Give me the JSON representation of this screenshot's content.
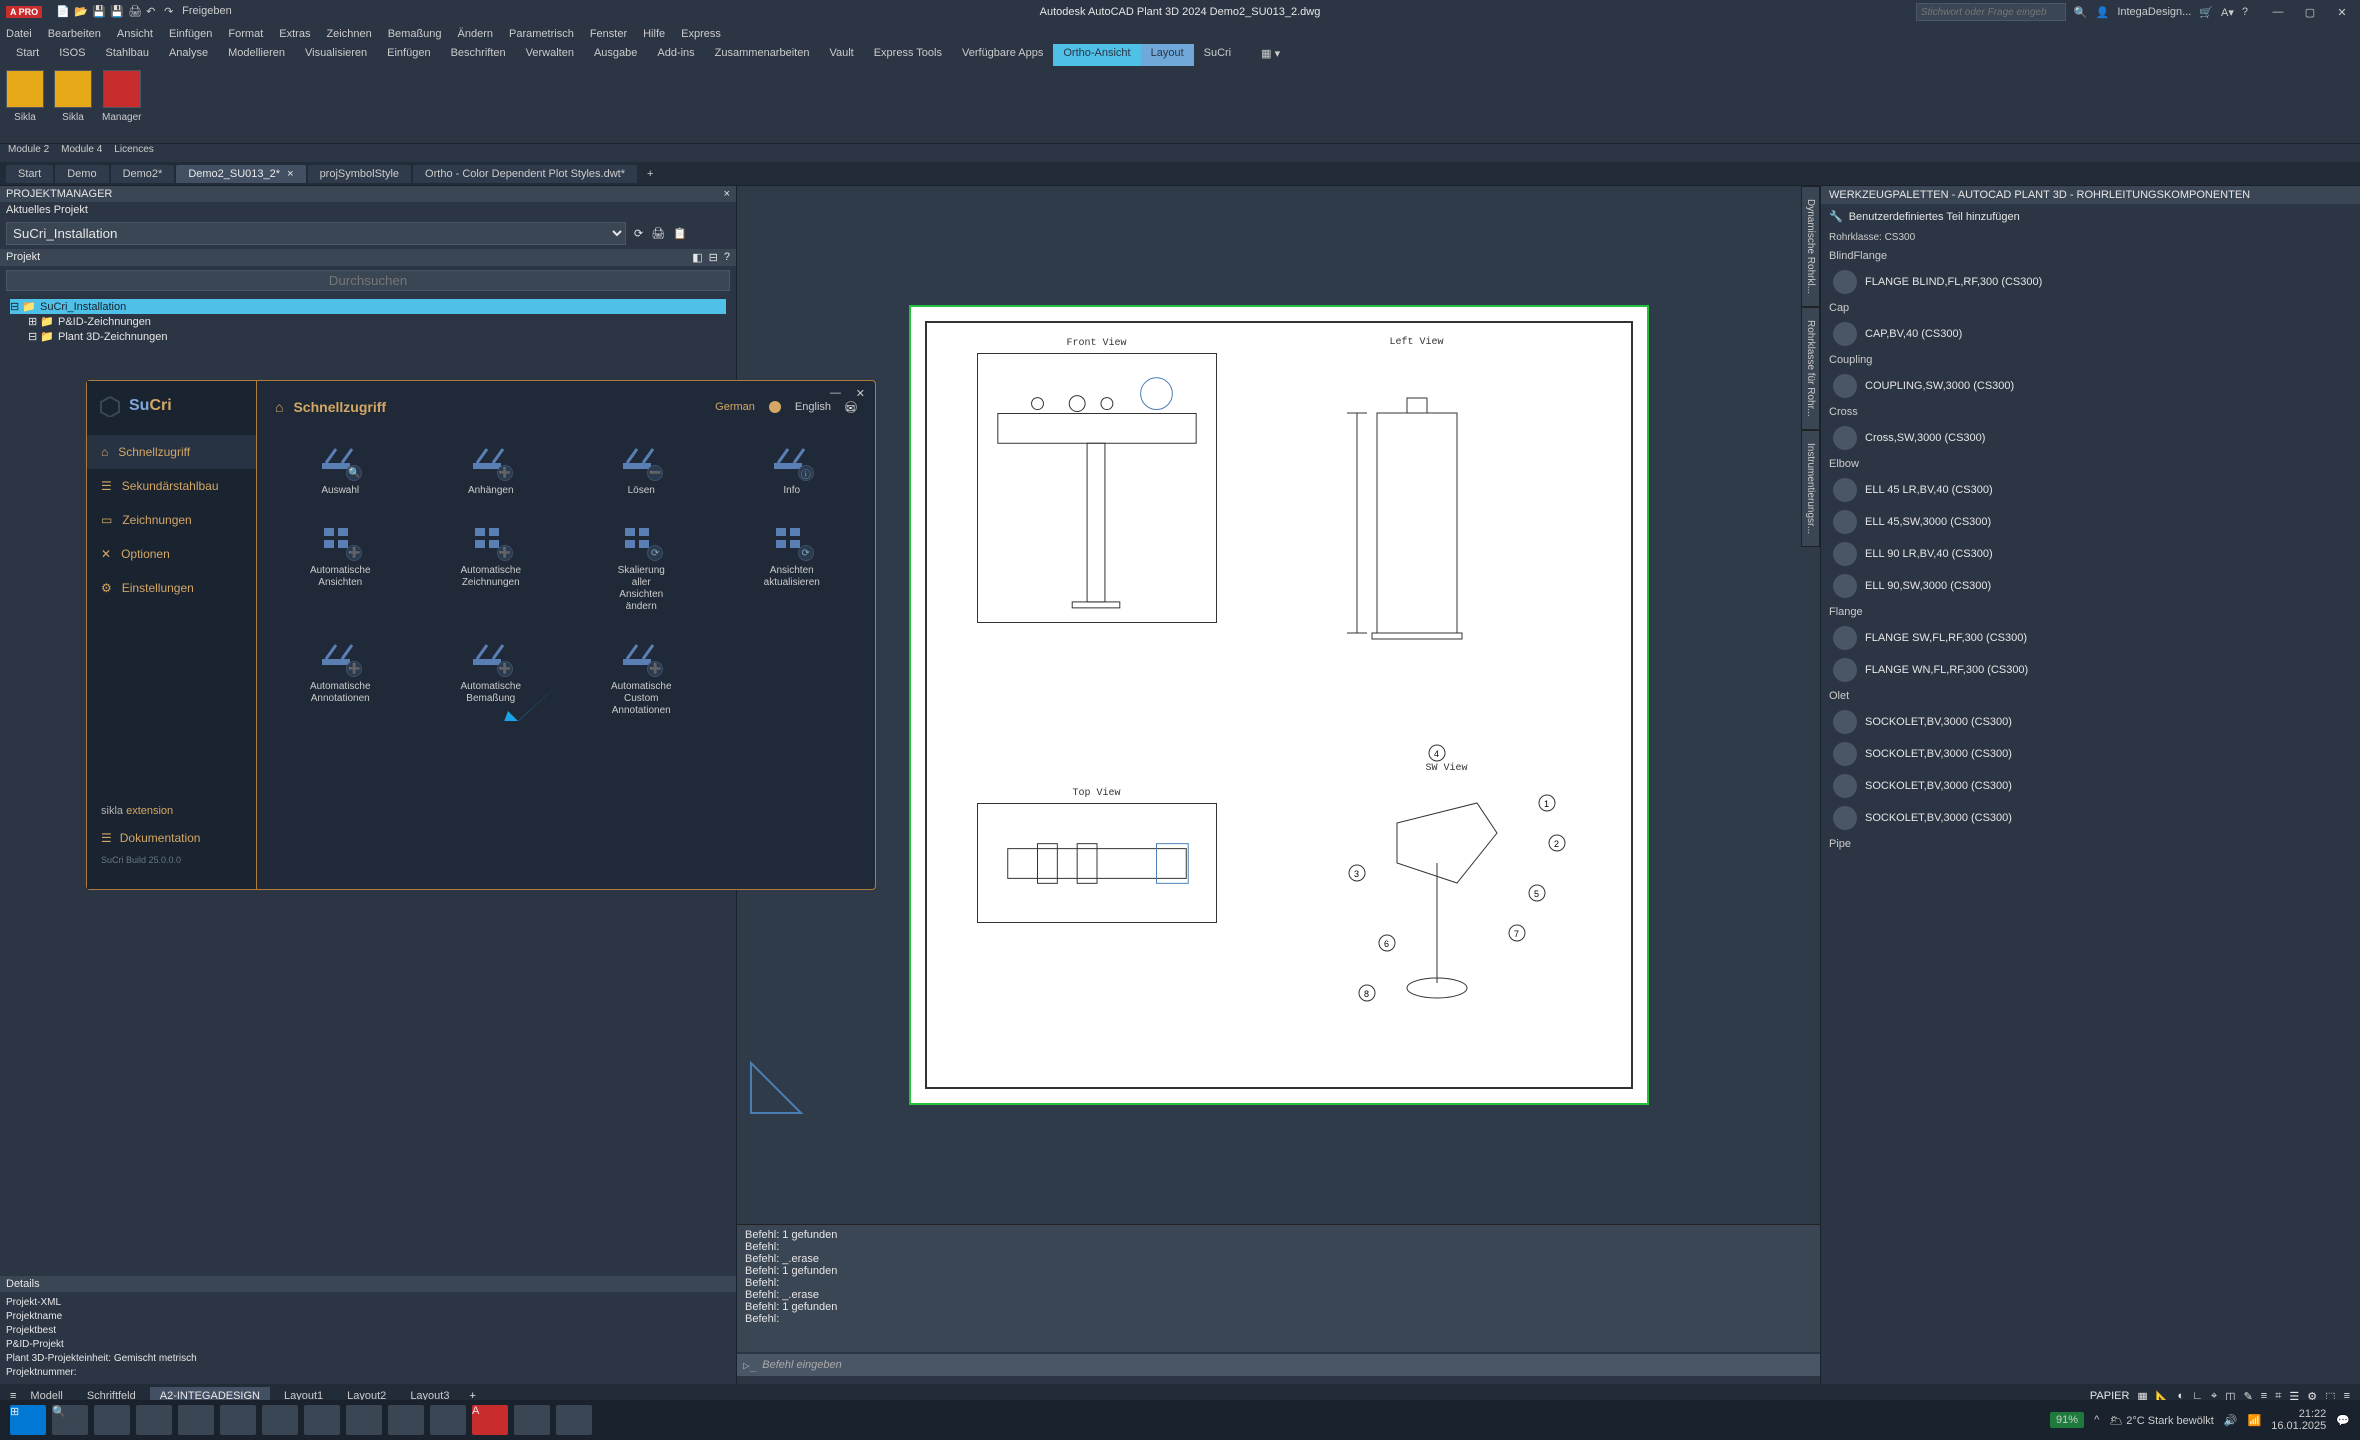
{
  "app": {
    "title": "Autodesk AutoCAD Plant 3D 2024   Demo2_SU013_2.dwg",
    "logo": "A PRO",
    "share": "Freigeben",
    "search_ph": "Stichwort oder Frage eingeben",
    "user": "IntegaDesign..."
  },
  "menus": [
    "Datei",
    "Bearbeiten",
    "Ansicht",
    "Einfügen",
    "Format",
    "Extras",
    "Zeichnen",
    "Bemaßung",
    "Ändern",
    "Parametrisch",
    "Fenster",
    "Hilfe",
    "Express"
  ],
  "ribbon_tabs": [
    "Start",
    "ISOS",
    "Stahlbau",
    "Analyse",
    "Modellieren",
    "Visualisieren",
    "Einfügen",
    "Beschriften",
    "Verwalten",
    "Ausgabe",
    "Add-ins",
    "Zusammenarbeiten",
    "Vault",
    "Express Tools",
    "Verfügbare Apps",
    "Ortho-Ansicht",
    "Layout",
    "SuCri"
  ],
  "ribbon_active": 15,
  "ribbon_active2": 16,
  "ribbon": {
    "g1": "Sikla",
    "g2": "Sikla",
    "g3": "Manager"
  },
  "ribbon_footer": [
    "Module 2",
    "Module 4",
    "Licences"
  ],
  "filetabs": [
    "Start",
    "Demo",
    "Demo2*",
    "Demo2_SU013_2*",
    "projSymbolStyle",
    "Ortho - Color Dependent Plot Styles.dwt*"
  ],
  "filetabs_active": 3,
  "project": {
    "panel": "PROJEKTMANAGER",
    "current_label": "Aktuelles Projekt",
    "current": "SuCri_Installation",
    "section": "Projekt",
    "search_ph": "Durchsuchen",
    "tree": {
      "root": "SuCri_Installation",
      "n1": "P&ID-Zeichnungen",
      "n2": "Plant 3D-Zeichnungen"
    },
    "details": "Details",
    "det_lines": [
      "Projekt-XML",
      "Projektname",
      "Projektbest",
      "P&ID-Projekt",
      "Plant 3D-Projekteinheit: Gemischt  metrisch",
      "Projektnummer:"
    ]
  },
  "right_panel": {
    "title": "WERKZEUGPALETTEN - AUTOCAD PLANT 3D - ROHRLEITUNGSKOMPONENTEN",
    "add_label": "Benutzerdefiniertes Teil hinzufügen",
    "class_label": "Rohrklasse: CS300",
    "side_tabs": [
      "Dynamische Rohrkl...",
      "Rohrklasse für Rohr...",
      "Instrumentierungsr..."
    ],
    "cats": [
      {
        "name": "BlindFlange",
        "items": [
          "FLANGE BLIND,FL,RF,300 (CS300)"
        ]
      },
      {
        "name": "Cap",
        "items": [
          "CAP,BV,40 (CS300)"
        ]
      },
      {
        "name": "Coupling",
        "items": [
          "COUPLING,SW,3000 (CS300)"
        ]
      },
      {
        "name": "Cross",
        "items": [
          "Cross,SW,3000 (CS300)"
        ]
      },
      {
        "name": "Elbow",
        "items": [
          "ELL 45 LR,BV,40 (CS300)",
          "ELL 45,SW,3000 (CS300)",
          "ELL 90 LR,BV,40 (CS300)",
          "ELL 90,SW,3000 (CS300)"
        ]
      },
      {
        "name": "Flange",
        "items": [
          "FLANGE SW,FL,RF,300 (CS300)",
          "FLANGE WN,FL,RF,300 (CS300)"
        ]
      },
      {
        "name": "Olet",
        "items": [
          "SOCKOLET,BV,3000 (CS300)",
          "SOCKOLET,BV,3000 (CS300)",
          "SOCKOLET,BV,3000 (CS300)",
          "SOCKOLET,BV,3000 (CS300)"
        ]
      },
      {
        "name": "Pipe",
        "items": []
      }
    ]
  },
  "views": {
    "front": "Front View",
    "left": "Left View",
    "top": "Top View",
    "sw": "SW View"
  },
  "cmd": {
    "history": [
      "Befehl: 1 gefunden",
      "Befehl:",
      "Befehl: _.erase",
      "Befehl: 1 gefunden",
      "Befehl:",
      "Befehl: _.erase",
      "Befehl: 1 gefunden",
      "Befehl:"
    ],
    "prompt": "Befehl eingeben"
  },
  "bottom_tabs": [
    "Modell",
    "Schriftfeld",
    "A2-INTEGADESIGN",
    "Layout1",
    "Layout2",
    "Layout3"
  ],
  "bottom_active": 2,
  "status": {
    "paper": "PAPIER",
    "batt": "91%"
  },
  "sucri": {
    "title": "Schnellzugriff",
    "lang_de": "German",
    "lang_en": "English",
    "nav": [
      "Schnellzugriff",
      "Sekundärstahlbau",
      "Zeichnungen",
      "Optionen",
      "Einstellungen"
    ],
    "nav_sel": 0,
    "ext": "extension",
    "sikla": "sikla",
    "doku": "Dokumentation",
    "build": "SuCri Build 25.0.0.0",
    "cards": [
      "Auswahl",
      "Anhängen",
      "Lösen",
      "Info",
      "Automatische Ansichten",
      "Automatische Zeichnungen",
      "Skalierung aller Ansichten ändern",
      "Ansichten aktualisieren",
      "Automatische Annotationen",
      "Automatische Bemaßung",
      "Automatische Custom Annotationen"
    ]
  },
  "os": {
    "temp": "2°C",
    "weather": "Stark bewölkt",
    "time": "21:22",
    "date": "16.01.2025"
  }
}
